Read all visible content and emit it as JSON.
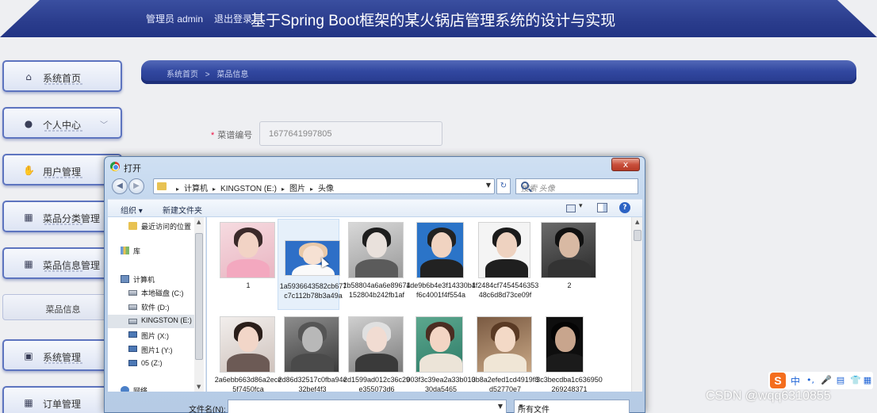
{
  "header": {
    "admin_label": "管理员 admin",
    "logout_label": "退出登录",
    "title": "基于Spring Boot框架的某火锅店管理系统的设计与实现"
  },
  "sidebar": {
    "items": [
      {
        "label": "系统首页",
        "icon": "home-icon"
      },
      {
        "label": "个人中心",
        "icon": "user-icon"
      },
      {
        "label": "用户管理",
        "icon": "thumb-icon"
      },
      {
        "label": "菜品分类管理",
        "icon": "grid-icon"
      },
      {
        "label": "菜品信息管理",
        "icon": "grid-icon"
      },
      {
        "label": "系统管理",
        "icon": "clipboard-icon"
      },
      {
        "label": "订单管理",
        "icon": "grid-icon"
      }
    ],
    "sub_item": "菜品信息"
  },
  "breadcrumb": {
    "home": "系统首页",
    "separator": ">",
    "current": "菜品信息"
  },
  "form": {
    "field1_label": "菜谱编号",
    "field1_required": "*",
    "field1_value": "1677641997805"
  },
  "dialog": {
    "title": "打开",
    "close_glyph": "x",
    "address_path": [
      "计算机",
      "KINGSTON (E:)",
      "图片",
      "头像"
    ],
    "search_placeholder": "搜索 头像",
    "organize_label": "组织 ▾",
    "new_folder_label": "新建文件夹",
    "nav_items": [
      {
        "label": "最近访问的位置",
        "icon": "folder"
      },
      {
        "label": "库",
        "icon": "library"
      },
      {
        "label": "计算机",
        "icon": "computer"
      },
      {
        "label": "本地磁盘 (C:)",
        "icon": "drive"
      },
      {
        "label": "软件 (D:)",
        "icon": "drive"
      },
      {
        "label": "KINGSTON (E:)",
        "icon": "drive"
      },
      {
        "label": "图片 (X:)",
        "icon": "monitor"
      },
      {
        "label": "图片1 (Y:)",
        "icon": "monitor"
      },
      {
        "label": "05  (Z:)",
        "icon": "monitor"
      },
      {
        "label": "网络",
        "icon": "network"
      }
    ],
    "files": [
      {
        "name": "1"
      },
      {
        "name": "1a5936643582cb677c7c112b78b3a49a"
      },
      {
        "name": "1b58804a6a6e89674152804b242fb1af"
      },
      {
        "name": "1de9b6b4e3f14330b4f6c4001f4f554a"
      },
      {
        "name": "1f2484cf745454635348c6d8d73ce09f"
      },
      {
        "name": "2"
      },
      {
        "name": "2a6ebb663d86a2ece5f7450fca"
      },
      {
        "name": "2d86d32517c0fba94e32bef4f3"
      },
      {
        "name": "2d1599ad012c36c29e355073d6"
      },
      {
        "name": "003f3c39ea2a33b01030da5465"
      },
      {
        "name": "3b8a2efed1cd4919f8d52770e7"
      },
      {
        "name": "3c3becdba1c636950269248371"
      }
    ],
    "filename_label": "文件名(N):",
    "filename_value": "",
    "filter_value": "所有文件"
  },
  "ime": {
    "logo": "S",
    "lang": "中"
  },
  "watermark": "CSDN @wqq6310855",
  "colors": {
    "header_blue": "#2a3c8c",
    "breadcrumb_blue": "#3248a0",
    "sidebar_border": "#5d74bf",
    "required_red": "#ee1144",
    "ime_orange": "#f46e1e"
  }
}
